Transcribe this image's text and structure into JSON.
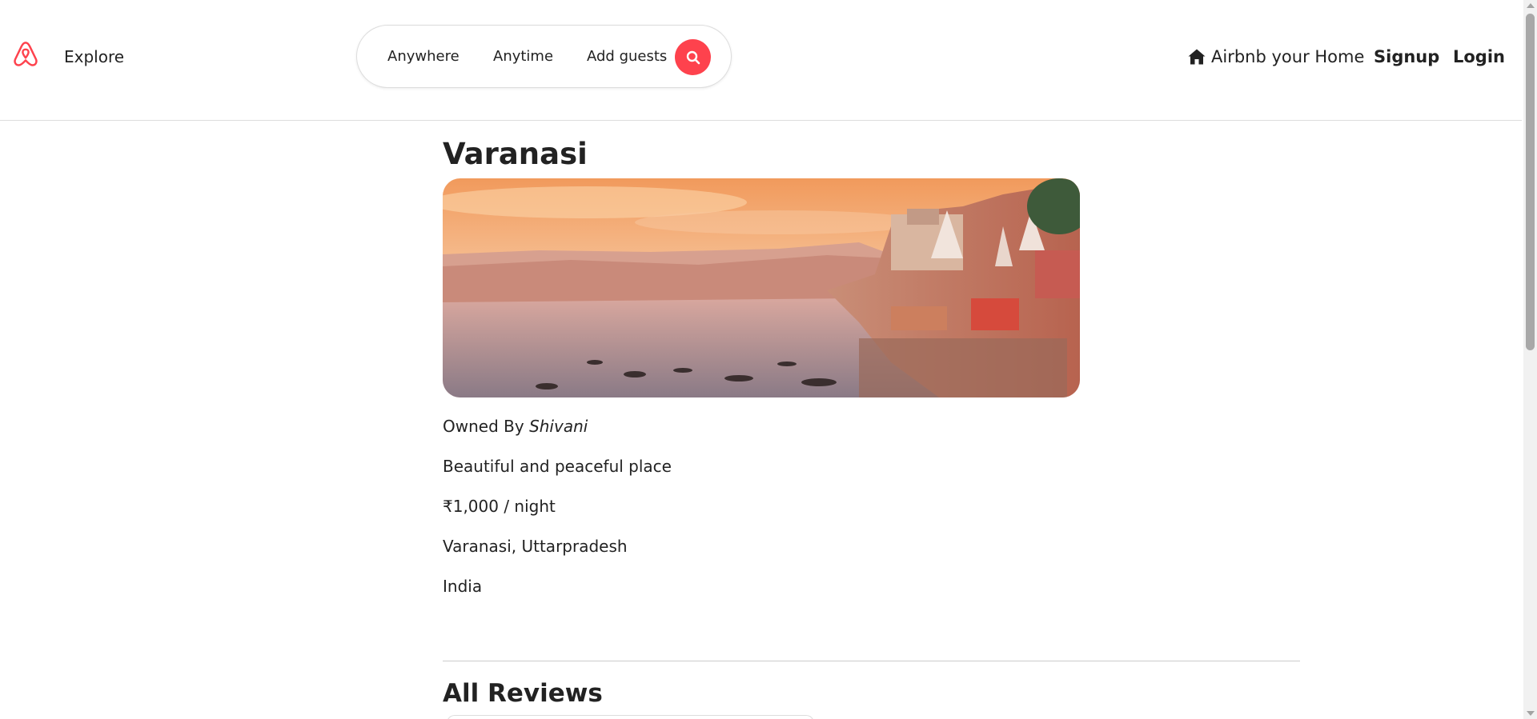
{
  "navbar": {
    "logo_icon": "airbnb-logo-icon",
    "explore_label": "Explore",
    "search": {
      "anywhere": "Anywhere",
      "anytime": "Anytime",
      "add_guests": "Add guests",
      "button_icon": "search-icon"
    },
    "host_icon": "home-icon",
    "host_label": "Airbnb your Home",
    "signup_label": "Signup",
    "login_label": "Login"
  },
  "listing": {
    "title": "Varanasi",
    "owner_prefix": "Owned By",
    "owner_name": "Shivani",
    "description": "Beautiful and peaceful place",
    "price": "₹1,000 / night",
    "location": "Varanasi, Uttarpradesh",
    "country": "India"
  },
  "reviews": {
    "heading": "All Reviews"
  },
  "colors": {
    "brand": "#fe424d",
    "text": "#222222",
    "border": "#dddddd"
  }
}
